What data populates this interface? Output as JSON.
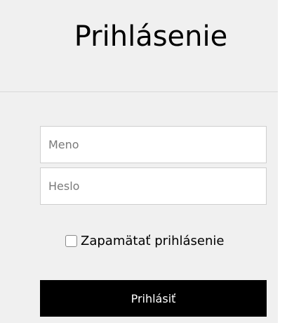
{
  "login": {
    "title": "Prihlásenie",
    "username": {
      "value": "",
      "placeholder": "Meno"
    },
    "password": {
      "value": "",
      "placeholder": "Heslo"
    },
    "remember": {
      "label": "Zapamätať prihlásenie",
      "checked": false
    },
    "submit_label": "Prihlásiť"
  },
  "colors": {
    "panel_background": "#f0f0f0",
    "button_background": "#000000",
    "button_text": "#ffffff"
  }
}
